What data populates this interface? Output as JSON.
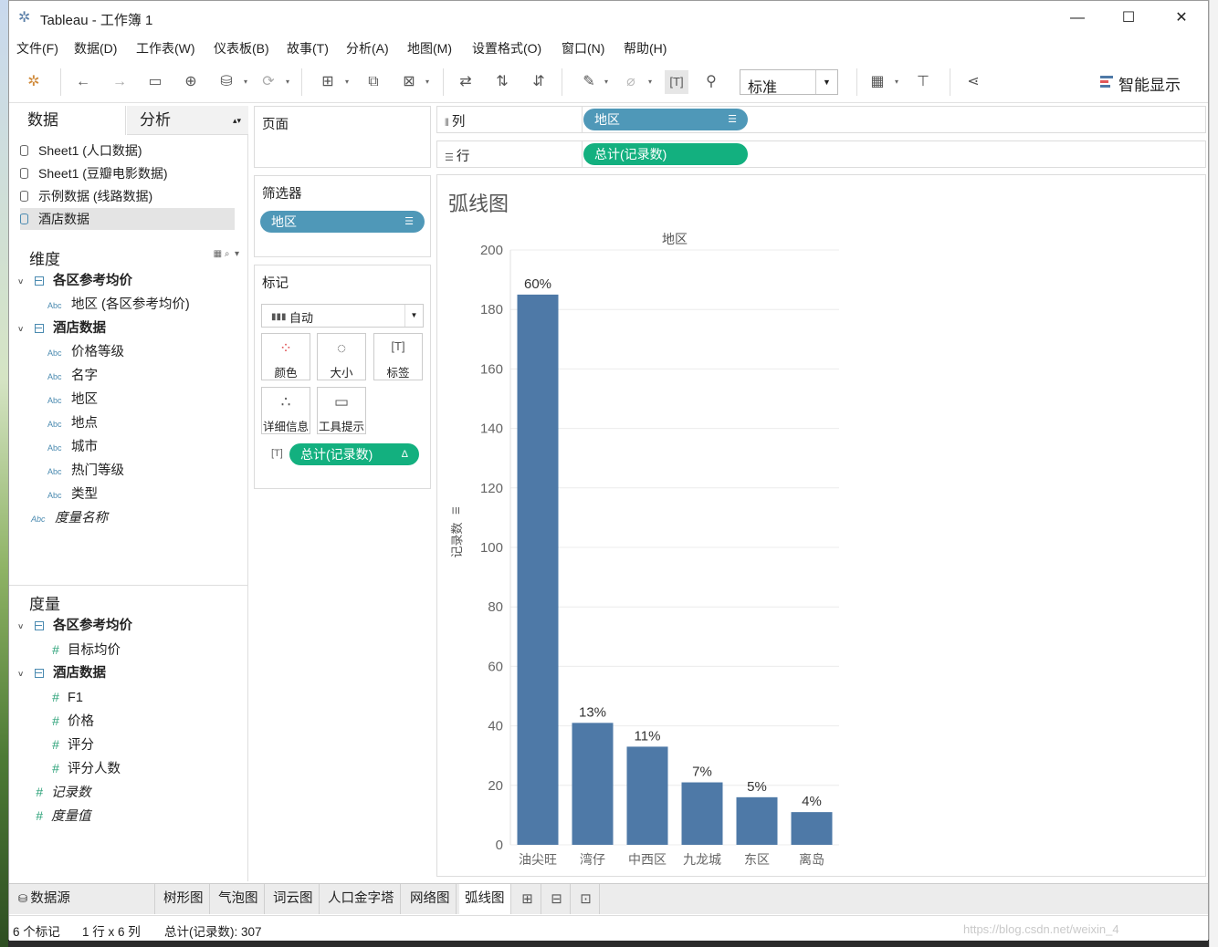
{
  "window": {
    "title": "Tableau - 工作簿 1"
  },
  "menu": [
    "文件(F)",
    "数据(D)",
    "工作表(W)",
    "仪表板(B)",
    "故事(T)",
    "分析(A)",
    "地图(M)",
    "设置格式(O)",
    "窗口(N)",
    "帮助(H)"
  ],
  "toolbar": {
    "fit": "标准",
    "show_me": "智能显示"
  },
  "data_pane": {
    "tab_data": "数据",
    "tab_analysis": "分析",
    "datasources": [
      "Sheet1 (人口数据)",
      "Sheet1 (豆瓣电影数据)",
      "示例数据 (线路数据)",
      "酒店数据"
    ],
    "dimensions_title": "维度",
    "dim_group1": "各区参考均价",
    "dim_group1_fields": [
      "地区 (各区参考均价)"
    ],
    "dim_group2": "酒店数据",
    "dim_group2_fields": [
      "价格等级",
      "名字",
      "地区",
      "地点",
      "城市",
      "热门等级",
      "类型"
    ],
    "dim_extra": "度量名称",
    "measures_title": "度量",
    "mea_group1": "各区参考均价",
    "mea_group1_fields": [
      "目标均价"
    ],
    "mea_group2": "酒店数据",
    "mea_group2_fields": [
      "F1",
      "价格",
      "评分",
      "评分人数"
    ],
    "mea_extra": [
      "记录数",
      "度量值"
    ],
    "abc_label": "Abc",
    "hash_label": "#"
  },
  "cards": {
    "pages": "页面",
    "filters": "筛选器",
    "filter_pill": "地区",
    "marks": "标记",
    "marks_type": "自动",
    "mark_buttons": [
      "颜色",
      "大小",
      "标签",
      "详细信息",
      "工具提示"
    ],
    "marks_pill": "总计(记录数)"
  },
  "shelves": {
    "columns_label": "列",
    "columns_pill": "地区",
    "rows_label": "行",
    "rows_pill": "总计(记录数)"
  },
  "viz": {
    "title": "弧线图"
  },
  "chart_data": {
    "type": "bar",
    "title": "",
    "header": "地区",
    "ylabel": "记录数",
    "categories": [
      "油尖旺",
      "湾仔",
      "中西区",
      "九龙城",
      "东区",
      "离岛"
    ],
    "values": [
      185,
      41,
      33,
      21,
      16,
      11
    ],
    "data_labels": [
      "60%",
      "13%",
      "11%",
      "7%",
      "5%",
      "4%"
    ],
    "ylim": [
      0,
      200
    ],
    "yticks": [
      0,
      20,
      40,
      60,
      80,
      100,
      120,
      140,
      160,
      180,
      200
    ],
    "bar_color": "#4e79a7",
    "grid": true
  },
  "sheet_tabs": {
    "datasource": "数据源",
    "tabs": [
      "树形图",
      "气泡图",
      "词云图",
      "人口金字塔",
      "网络图",
      "弧线图"
    ],
    "active": "弧线图"
  },
  "status": {
    "marks": "6 个标记",
    "rows_cols": "1 行 x 6 列",
    "sum": "总计(记录数): 307"
  },
  "watermark": "https://blog.csdn.net/weixin_4"
}
